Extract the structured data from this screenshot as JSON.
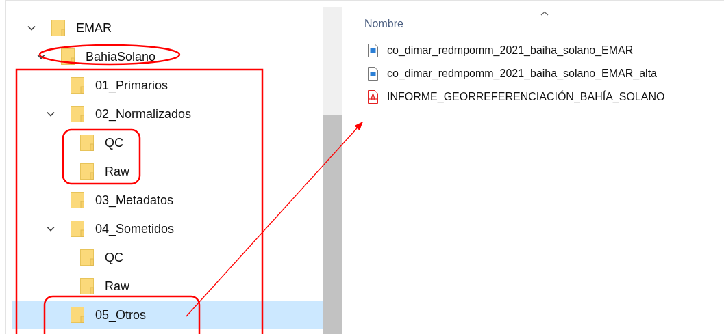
{
  "tree": [
    {
      "label": "EMAR",
      "expanded": true,
      "selected": false,
      "children": [
        {
          "label": "BahiaSolano",
          "expanded": true,
          "selected": false,
          "children": [
            {
              "label": "01_Primarios",
              "selected": false
            },
            {
              "label": "02_Normalizados",
              "expanded": true,
              "selected": false,
              "children": [
                {
                  "label": "QC",
                  "selected": false
                },
                {
                  "label": "Raw",
                  "selected": false
                }
              ]
            },
            {
              "label": "03_Metadatos",
              "selected": false
            },
            {
              "label": "04_Sometidos",
              "expanded": true,
              "selected": false,
              "children": [
                {
                  "label": "QC",
                  "selected": false
                },
                {
                  "label": "Raw",
                  "selected": false
                }
              ]
            },
            {
              "label": "05_Otros",
              "selected": true
            }
          ]
        }
      ]
    }
  ],
  "files": {
    "column": "Nombre",
    "items": [
      {
        "name": "co_dimar_redmpomm_2021_baiha_solano_EMAR",
        "kind": "image"
      },
      {
        "name": "co_dimar_redmpomm_2021_baiha_solano_EMAR_alta",
        "kind": "image"
      },
      {
        "name": "INFORME_GEORREFERENCIACIÓN_BAHÍA_SOLANO",
        "kind": "pdf"
      }
    ]
  }
}
